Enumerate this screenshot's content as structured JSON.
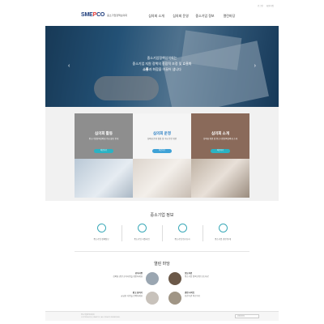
{
  "util_links": [
    "로그인",
    "회원가입"
  ],
  "logo": {
    "mark_main": "SME",
    "mark_accent": "P",
    "mark_tail": "CO",
    "text": "중소기업정책심의회"
  },
  "gnb": [
    "심의회 소개",
    "심의회 운영",
    "중소기업 정보",
    "열린마당"
  ],
  "hero": {
    "line1": "중소기업정책심의회는",
    "line2": "중소기업 지원 정책의 종합적 조정 및 효율화",
    "line3_bold": "소통",
    "line3_rest": "과 화합을 이끌어 냅니다"
  },
  "cards": [
    {
      "title": "심의회 활동",
      "desc": "중소기업정책심의회 주요 활동 안내",
      "btn": "바로가기"
    },
    {
      "title": "심의회 운영",
      "desc": "심의회 운영 일정 및 주요 안건 확인",
      "btn": "바로가기"
    },
    {
      "title": "심의회 소개",
      "desc": "심의회 위원 및 중소기업정책심의회 소개",
      "btn": "바로가기"
    }
  ],
  "info": {
    "title": "중소기업 정보",
    "items": [
      "중소기업 정책정보",
      "중소기업 지원사업",
      "중소기업 연구조사",
      "중소기업 관련 통계"
    ]
  },
  "board": {
    "title": "열린 마당",
    "items": [
      {
        "head": "공지사항",
        "body": "심의회 관련 공지사항을 확인하세요"
      },
      {
        "head": "보도자료",
        "body": "중소기업 정책 관련 보도자료"
      },
      {
        "head": "묻고 답하기",
        "body": "궁금한 사항을 문의하세요"
      },
      {
        "head": "관련 사이트",
        "body": "유관기관 바로가기"
      }
    ]
  },
  "footer": {
    "line1": "중소기업정책심의회",
    "line2": "COPYRIGHT(C) SMEPCO. ALL RIGHTS RESERVED.",
    "family": "관련사이트"
  }
}
